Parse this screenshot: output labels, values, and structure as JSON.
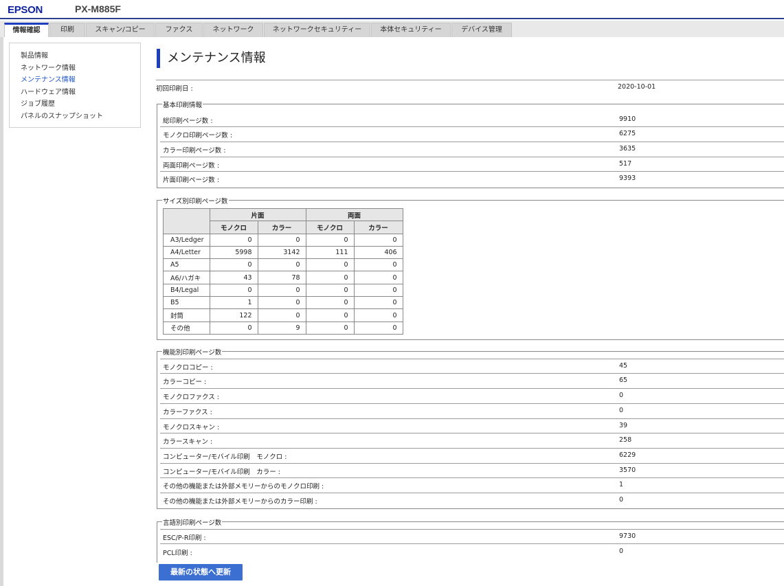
{
  "header": {
    "brand": "EPSON",
    "model": "PX-M885F"
  },
  "tabs": [
    {
      "label": "情報確認",
      "active": true
    },
    {
      "label": "印刷"
    },
    {
      "label": "スキャン/コピー"
    },
    {
      "label": "ファクス"
    },
    {
      "label": "ネットワーク"
    },
    {
      "label": "ネットワークセキュリティー"
    },
    {
      "label": "本体セキュリティー"
    },
    {
      "label": "デバイス管理"
    }
  ],
  "sidebar": {
    "items": [
      {
        "label": "製品情報"
      },
      {
        "label": "ネットワーク情報"
      },
      {
        "label": "メンテナンス情報",
        "active": true
      },
      {
        "label": "ハードウェア情報"
      },
      {
        "label": "ジョブ履歴"
      },
      {
        "label": "パネルのスナップショット"
      }
    ]
  },
  "page": {
    "title": "メンテナンス情報",
    "first_print": {
      "label": "初回印刷日 :",
      "value": "2020-10-01"
    },
    "basic": {
      "legend": "基本印刷情報",
      "rows": [
        {
          "label": "総印刷ページ数 :",
          "value": "9910"
        },
        {
          "label": "モノクロ印刷ページ数 :",
          "value": "6275"
        },
        {
          "label": "カラー印刷ページ数 :",
          "value": "3635"
        },
        {
          "label": "両面印刷ページ数 :",
          "value": "517"
        },
        {
          "label": "片面印刷ページ数 :",
          "value": "9393"
        }
      ]
    },
    "size": {
      "legend": "サイズ別印刷ページ数",
      "group_headers": [
        "片面",
        "両面"
      ],
      "sub_headers": [
        "モノクロ",
        "カラー",
        "モノクロ",
        "カラー"
      ],
      "rows": [
        {
          "label": "A3/Ledger",
          "cells": [
            "0",
            "0",
            "0",
            "0"
          ]
        },
        {
          "label": "A4/Letter",
          "cells": [
            "5998",
            "3142",
            "111",
            "406"
          ]
        },
        {
          "label": "A5",
          "cells": [
            "0",
            "0",
            "0",
            "0"
          ]
        },
        {
          "label": "A6/ハガキ",
          "cells": [
            "43",
            "78",
            "0",
            "0"
          ]
        },
        {
          "label": "B4/Legal",
          "cells": [
            "0",
            "0",
            "0",
            "0"
          ]
        },
        {
          "label": "B5",
          "cells": [
            "1",
            "0",
            "0",
            "0"
          ]
        },
        {
          "label": "封筒",
          "cells": [
            "122",
            "0",
            "0",
            "0"
          ]
        },
        {
          "label": "その他",
          "cells": [
            "0",
            "9",
            "0",
            "0"
          ]
        }
      ]
    },
    "function": {
      "legend": "機能別印刷ページ数",
      "rows": [
        {
          "label": "モノクロコピー :",
          "value": "45"
        },
        {
          "label": "カラーコピー :",
          "value": "65"
        },
        {
          "label": "モノクロファクス :",
          "value": "0"
        },
        {
          "label": "カラーファクス :",
          "value": "0"
        },
        {
          "label": "モノクロスキャン :",
          "value": "39"
        },
        {
          "label": "カラースキャン :",
          "value": "258"
        },
        {
          "label": "コンピューター/モバイル印刷　モノクロ :",
          "value": "6229"
        },
        {
          "label": "コンピューター/モバイル印刷　カラー :",
          "value": "3570"
        },
        {
          "label": "その他の機能または外部メモリーからのモノクロ印刷 :",
          "value": "1"
        },
        {
          "label": "その他の機能または外部メモリーからのカラー印刷 :",
          "value": "0"
        }
      ]
    },
    "language": {
      "legend": "言語別印刷ページ数",
      "rows": [
        {
          "label": "ESC/P-R印刷 :",
          "value": "9730"
        },
        {
          "label": "PCL印刷 :",
          "value": "0"
        }
      ]
    }
  },
  "refresh_button": "最新の状態へ更新"
}
